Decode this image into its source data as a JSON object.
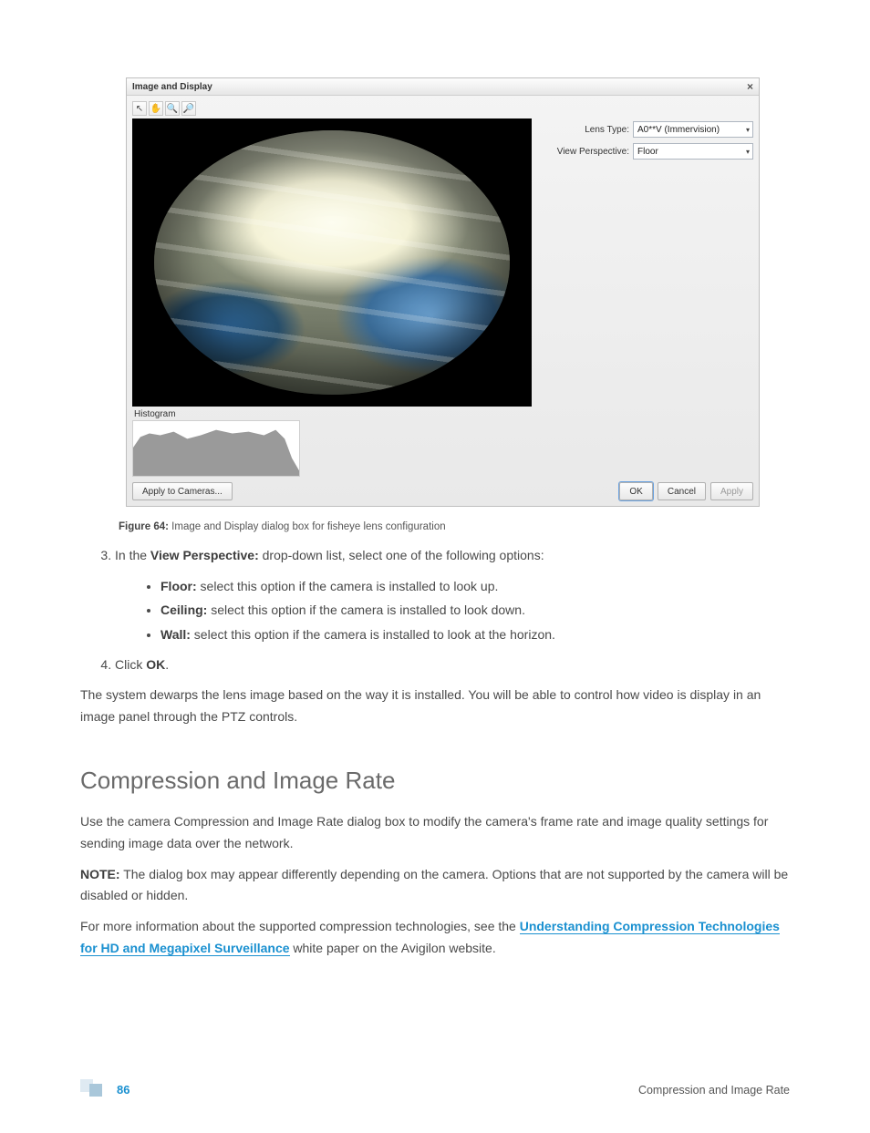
{
  "dialog": {
    "title": "Image and Display",
    "close_glyph": "×",
    "toolbar": {
      "pointer": "↖",
      "hand": "✋",
      "zoom_in": "⊕",
      "zoom_out": "⊖"
    },
    "histogram_label": "Histogram",
    "fields": {
      "lens_type_label": "Lens Type:",
      "lens_type_value": "A0**V (Immervision)",
      "view_perspective_label": "View Perspective:",
      "view_perspective_value": "Floor"
    },
    "buttons": {
      "apply_to_cameras": "Apply to Cameras...",
      "ok": "OK",
      "cancel": "Cancel",
      "apply": "Apply"
    }
  },
  "caption": {
    "prefix": "Figure 64:",
    "text": " Image and Display dialog box for fisheye lens configuration"
  },
  "step3": {
    "lead_in": "In the ",
    "term": "View Perspective:",
    "tail": " drop-down list, select one of the following options:",
    "options": {
      "floor_term": "Floor:",
      "floor_text": " select this option if the camera is installed to look up.",
      "ceiling_term": "Ceiling:",
      "ceiling_text": " select this option if the camera is installed to look down.",
      "wall_term": "Wall:",
      "wall_text": " select this option if the camera is installed to look at the horizon."
    }
  },
  "step4": {
    "lead_in": "Click ",
    "term": "OK",
    "tail": "."
  },
  "paragraph_dewarp": "The system dewarps the lens image based on the way it is installed. You will be able to control how video is display in an image panel through the PTZ controls.",
  "section_heading": "Compression and Image Rate",
  "paragraph_intro": "Use the camera Compression and Image Rate dialog box to modify the camera's frame rate and image quality settings for sending image data over the network.",
  "note": {
    "prefix": "NOTE:",
    "text": " The dialog box may appear differently depending on the camera. Options that are not supported by the camera will be disabled or hidden."
  },
  "paragraph_link": {
    "pre": "For more information about the supported compression technologies, see the ",
    "link": "Understanding Compression Technologies for HD and Megapixel Surveillance",
    "post": " white paper on the Avigilon website."
  },
  "footer": {
    "page_number": "86",
    "section": "Compression and Image Rate"
  }
}
